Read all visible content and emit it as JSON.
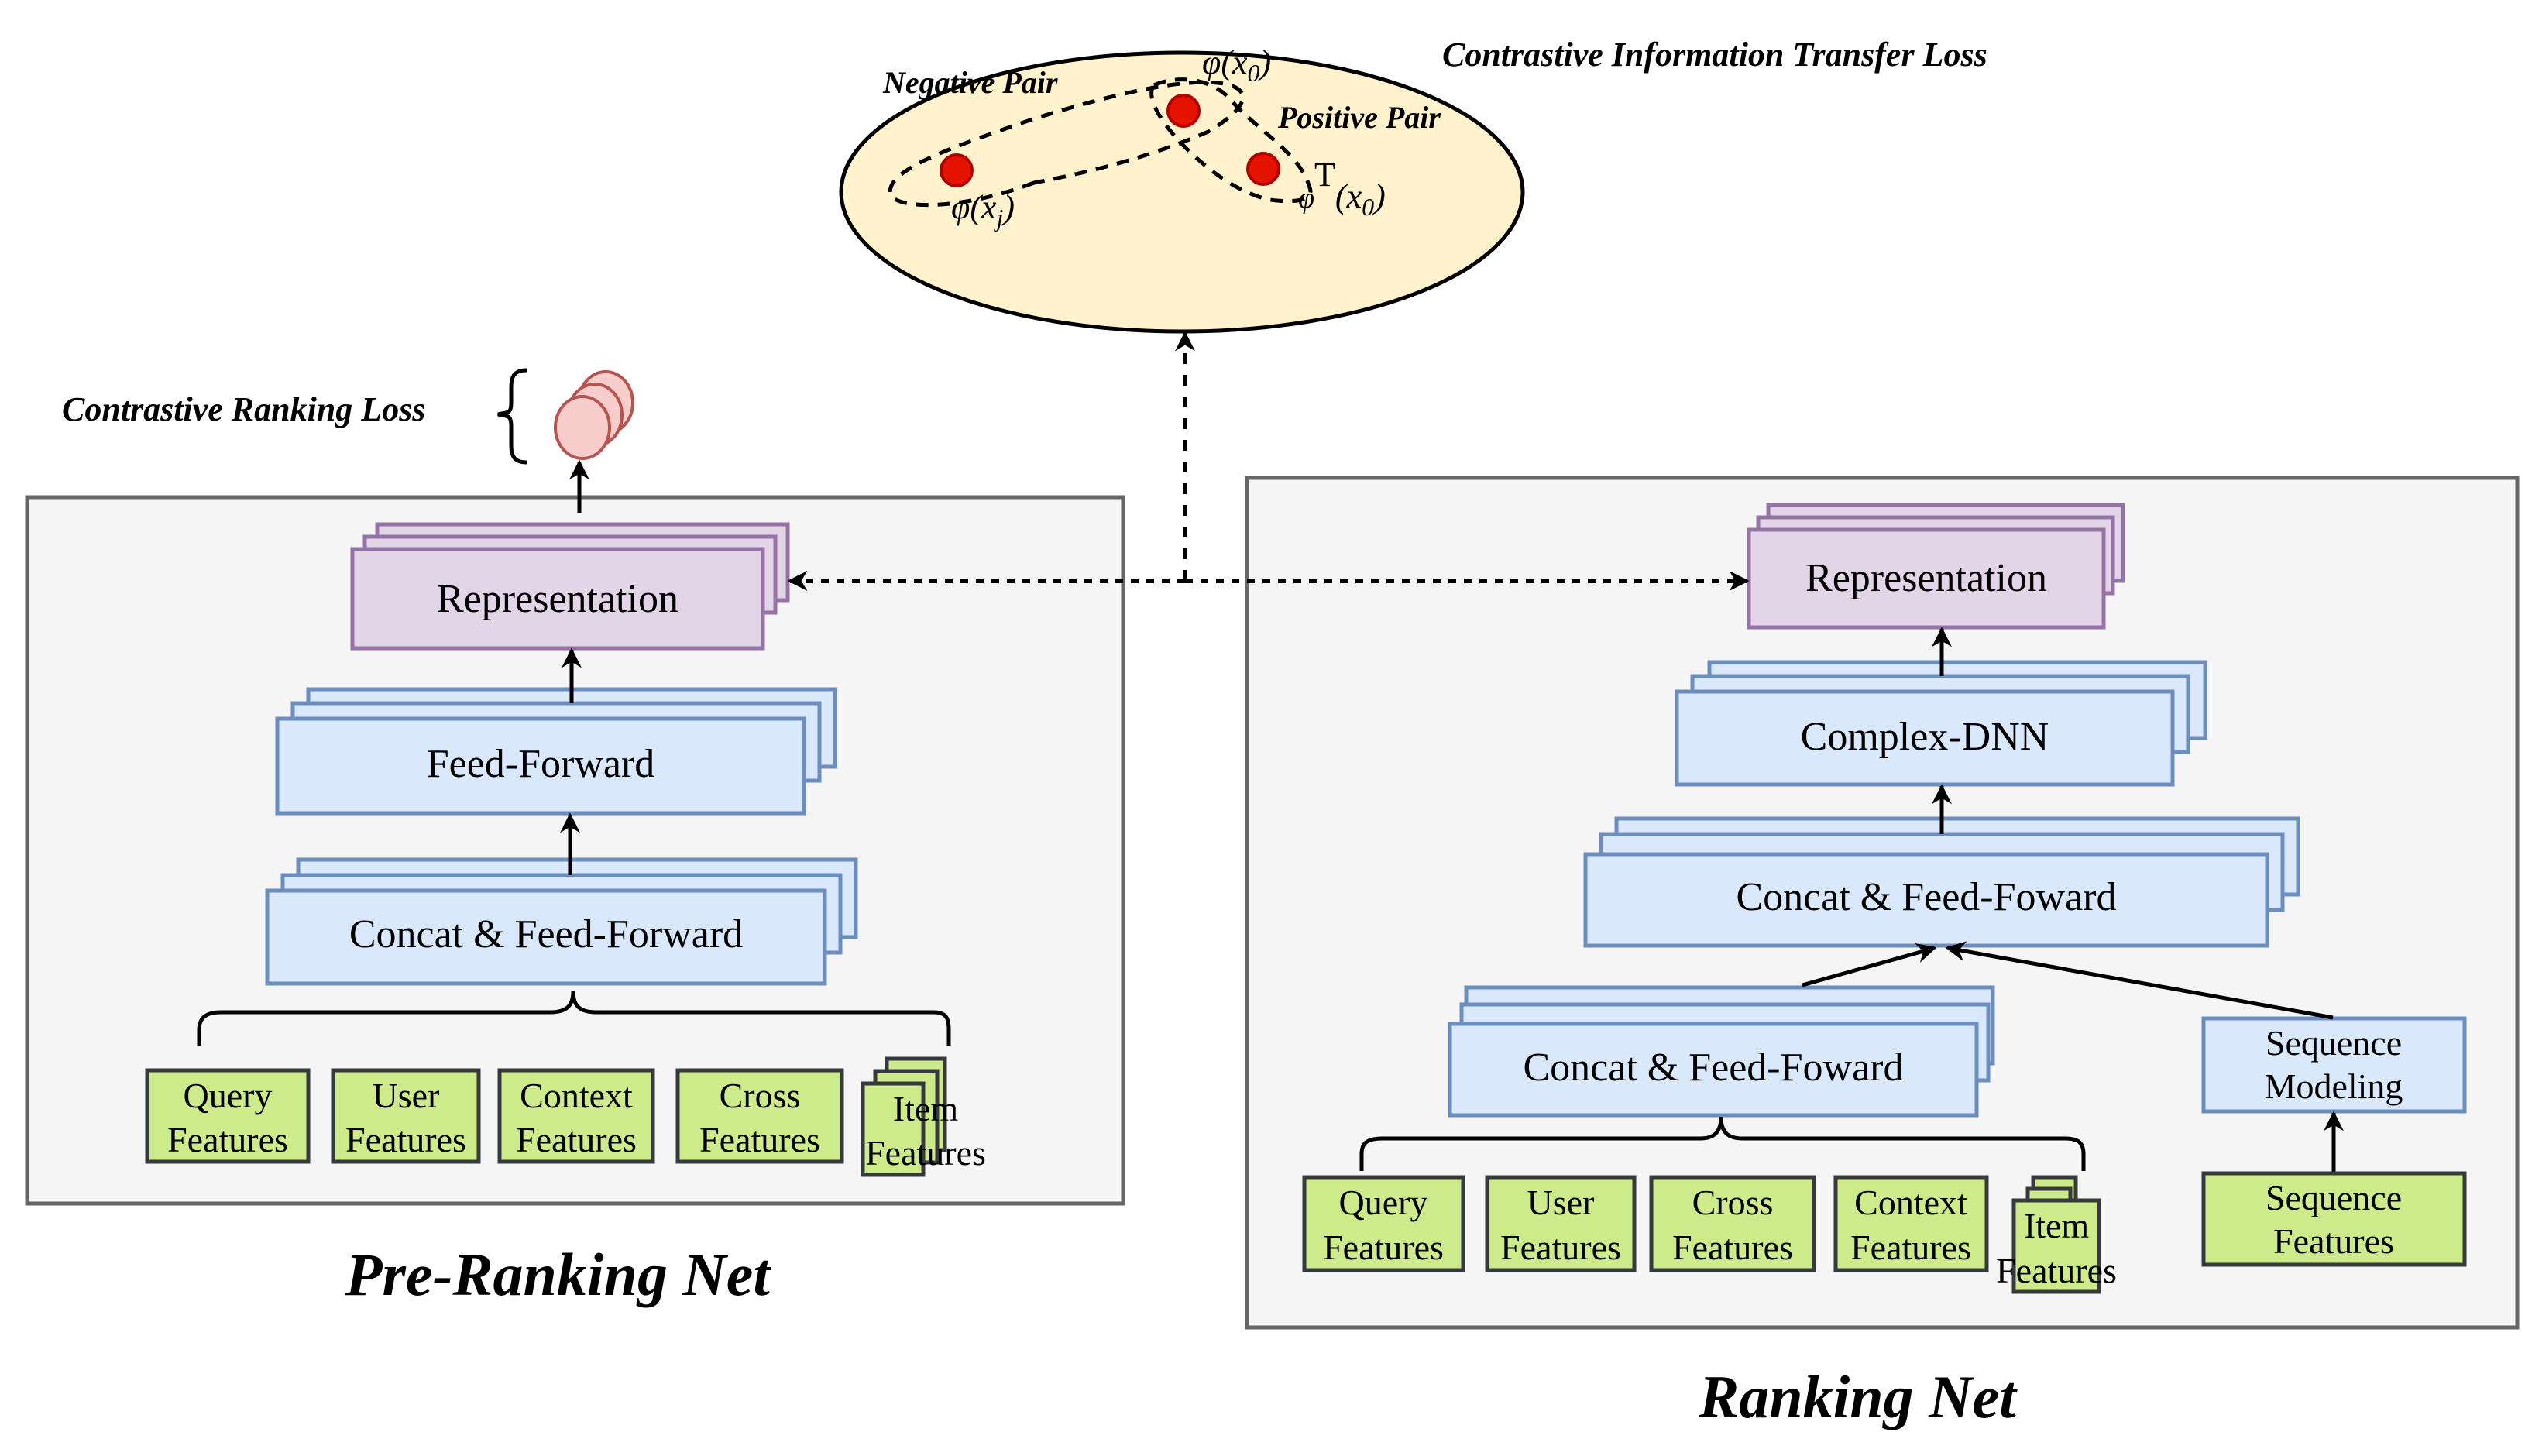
{
  "title_top": "Contrastive Information Transfer Loss",
  "embedding_space": {
    "negative_pair_label": "Negative Pair",
    "positive_pair_label": "Positive Pair",
    "anchor_label": "φ(x",
    "anchor_sub": "0",
    "negative_label": "φ(x",
    "negative_sub": "j",
    "positive_label_base": "φ",
    "positive_label_sup": "T",
    "positive_label_arg": "(x",
    "positive_label_sub": "0",
    "close_paren": ")",
    "colors": {
      "ellipse_fill": "#fff2cc",
      "point_fill": "#e51400",
      "point_stroke": "#b20000"
    }
  },
  "contrastive_ranking_loss_label": "Contrastive Ranking Loss",
  "pre_ranking_net": {
    "title": "Pre-Ranking Net",
    "representation": "Representation",
    "feed_forward": "Feed-Forward",
    "concat_ff": "Concat & Feed-Forward",
    "features": [
      {
        "line1": "Query",
        "line2": "Features"
      },
      {
        "line1": "User",
        "line2": "Features"
      },
      {
        "line1": "Context",
        "line2": "Features"
      },
      {
        "line1": "Cross",
        "line2": "Features"
      },
      {
        "line1": "Item",
        "line2": "Features"
      }
    ]
  },
  "ranking_net": {
    "title": "Ranking Net",
    "representation": "Representation",
    "complex_dnn": "Complex-DNN",
    "concat_ff_top": "Concat & Feed-Foward",
    "concat_ff_bottom": "Concat & Feed-Foward",
    "sequence_modeling_line1": "Sequence",
    "sequence_modeling_line2": "Modeling",
    "features": [
      {
        "line1": "Query",
        "line2": "Features"
      },
      {
        "line1": "User",
        "line2": "Features"
      },
      {
        "line1": "Cross",
        "line2": "Features"
      },
      {
        "line1": "Context",
        "line2": "Features"
      },
      {
        "line1": "Item",
        "line2": "Features"
      }
    ],
    "sequence_features": {
      "line1": "Sequence",
      "line2": "Features"
    }
  },
  "colors": {
    "panel_fill": "#f5f5f5",
    "panel_stroke": "#666666",
    "purple_fill": "#e1d5e7",
    "purple_stroke": "#9673a6",
    "blue_fill": "#dae8fc",
    "blue_stroke": "#6c8ebf",
    "green_fill": "#cdeb8b",
    "green_stroke": "#36393d",
    "loss_fill": "#f8cecc",
    "loss_stroke": "#b85450"
  }
}
